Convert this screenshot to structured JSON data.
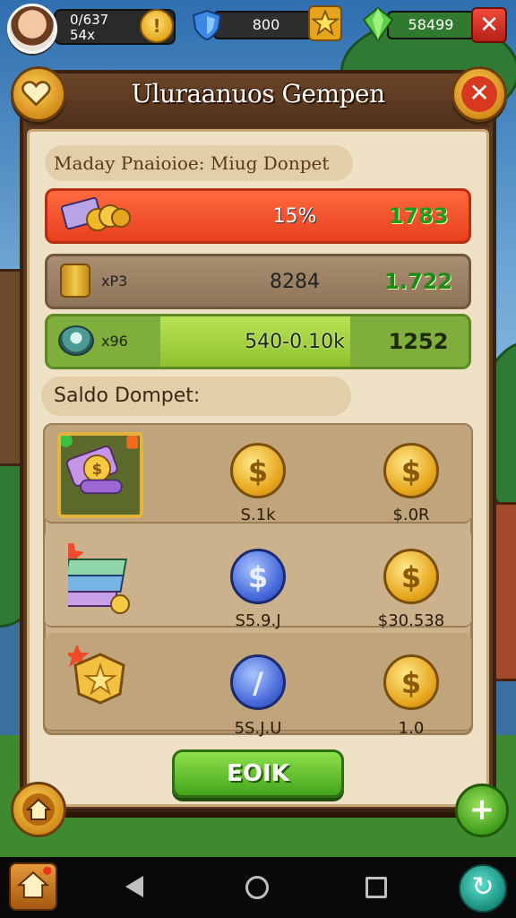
{
  "hud": {
    "player_line1": "0/637",
    "player_line2": "54x",
    "coin_symbol": "!",
    "shield_value": "800",
    "gems_value": "58499",
    "close_symbol": "✕"
  },
  "dialog": {
    "title": "Uluraanuos Gempen",
    "subtitle": "Maday Pnaioioe: Miug Donpet",
    "close_symbol": "✕",
    "rows": [
      {
        "left": "",
        "mid": "15%",
        "right": "1783"
      },
      {
        "left": "xP3",
        "mid": "8284",
        "right": "1.722"
      },
      {
        "left": "x96",
        "mid": "540-0.10k",
        "right": "1252"
      }
    ],
    "saldo_label": "Saldo Dompet:",
    "grid": [
      {
        "col1": "S.1k",
        "col2": "$.0R",
        "coin1": "gold",
        "coin2": "gold"
      },
      {
        "col1": "S5.9.J",
        "col2": "$30.538",
        "coin1": "blue",
        "coin2": "gold"
      },
      {
        "col1": "5S.J.U",
        "col2": "1.0",
        "coin1": "blue",
        "coin2": "gold"
      }
    ],
    "ok_label": "EOIK"
  },
  "icons": {
    "coin_symbol": "$",
    "blue_coin_symbol_3": "/",
    "plus_symbol": "+",
    "refresh_symbol": "↻"
  },
  "colors": {
    "row1": "#ff6a3d",
    "row2": "#a98e72",
    "row3": "#7fae3c",
    "ok_button": "#44a51c",
    "panel": "#efe1c6"
  }
}
